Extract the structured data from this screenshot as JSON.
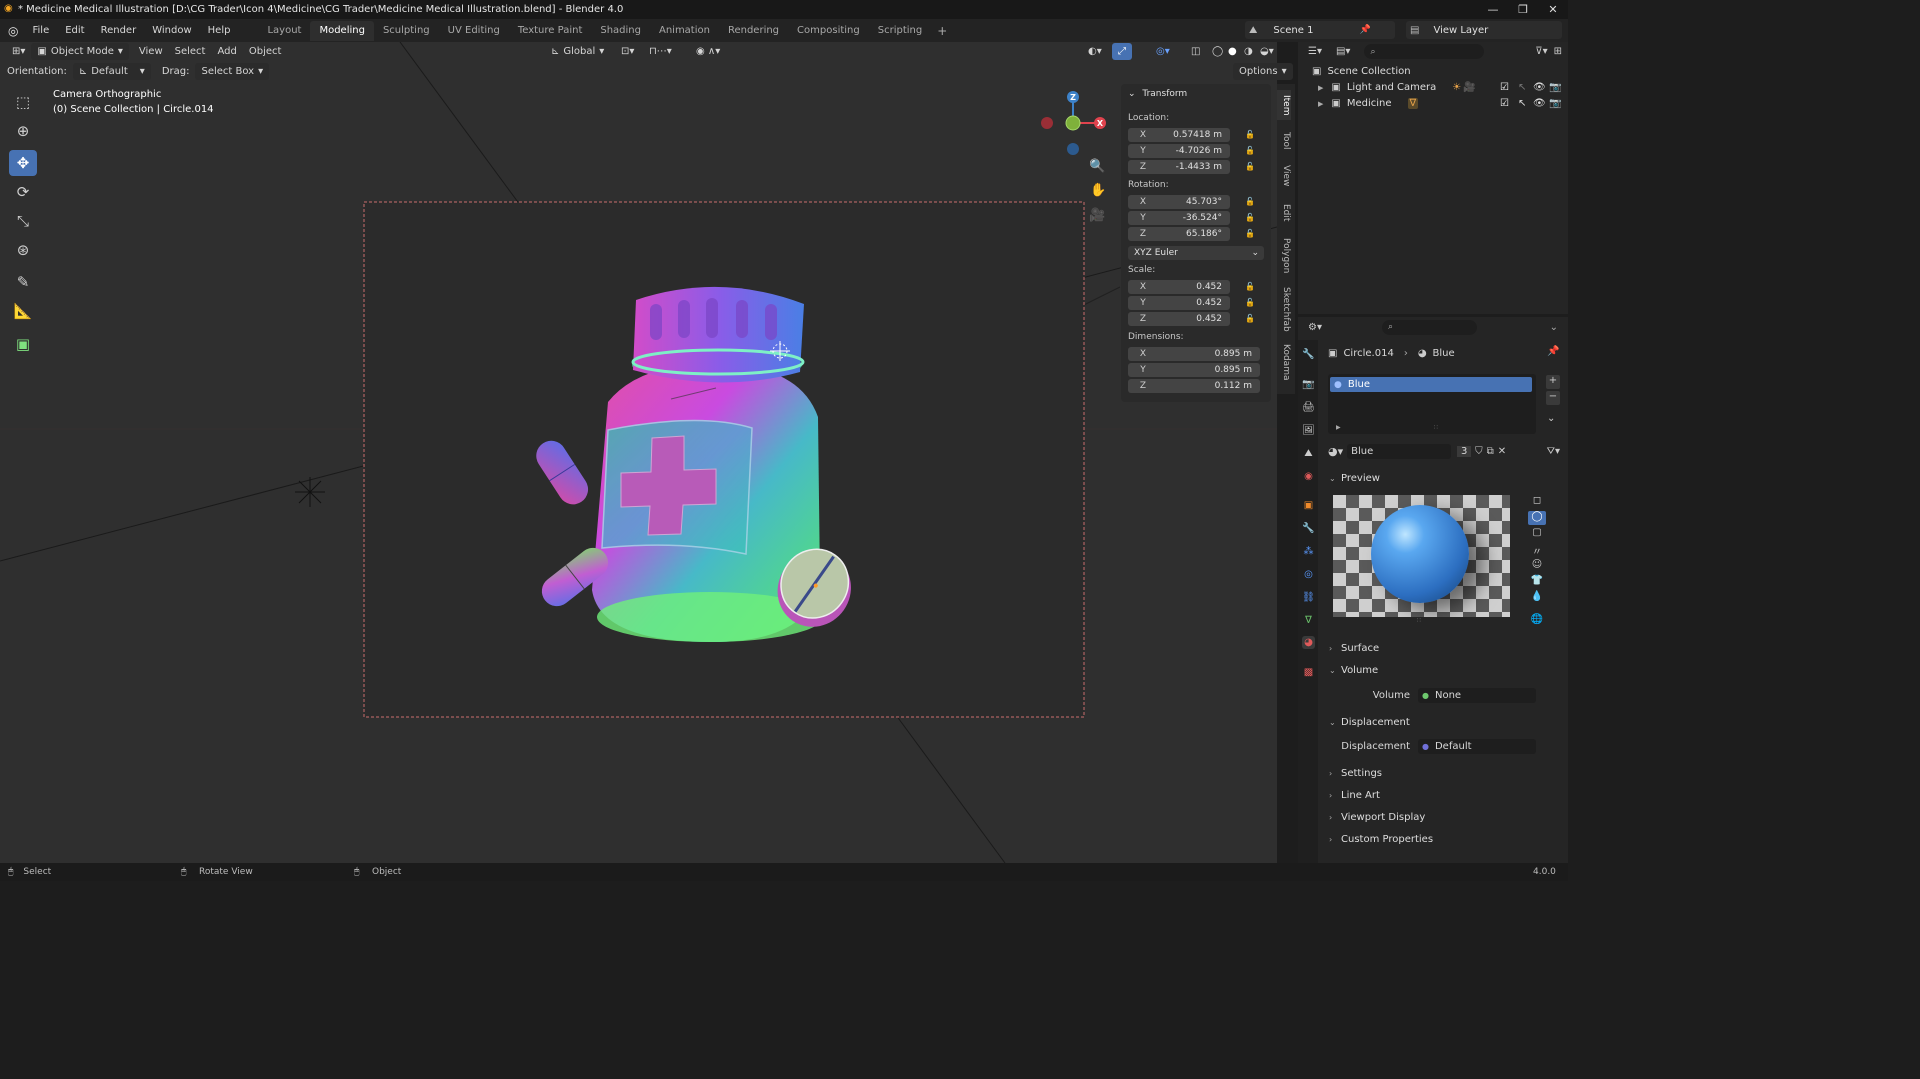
{
  "window": {
    "title": "* Medicine Medical Illustration [D:\\CG Trader\\Icon 4\\Medicine\\CG Trader\\Medicine Medical Illustration.blend] - Blender 4.0"
  },
  "menu": [
    "File",
    "Edit",
    "Render",
    "Window",
    "Help"
  ],
  "workspaces": [
    "Layout",
    "Modeling",
    "Sculpting",
    "UV Editing",
    "Texture Paint",
    "Shading",
    "Animation",
    "Rendering",
    "Compositing",
    "Scripting"
  ],
  "active_workspace": "Modeling",
  "scene": "Scene 1",
  "view_layer": "View Layer",
  "viewport_header": {
    "mode": "Object Mode",
    "menus": [
      "View",
      "Select",
      "Add",
      "Object"
    ],
    "transform_orientation": "Global",
    "options": "Options"
  },
  "tool_settings": {
    "orientation_label": "Orientation:",
    "orientation_value": "Default",
    "drag_label": "Drag:",
    "drag_value": "Select Box"
  },
  "overlay_text": {
    "view_name": "Camera Orthographic",
    "collection_info": "(0) Scene Collection | Circle.014"
  },
  "transform_panel": {
    "title": "Transform",
    "location_label": "Location:",
    "location": {
      "x": "0.57418 m",
      "y": "-4.7026 m",
      "z": "-1.4433 m"
    },
    "rotation_label": "Rotation:",
    "rotation": {
      "x": "45.703°",
      "y": "-36.524°",
      "z": "65.186°"
    },
    "rotation_mode": "XYZ Euler",
    "scale_label": "Scale:",
    "scale": {
      "x": "0.452",
      "y": "0.452",
      "z": "0.452"
    },
    "dimensions_label": "Dimensions:",
    "dimensions": {
      "x": "0.895 m",
      "y": "0.895 m",
      "z": "0.112 m"
    }
  },
  "sidebar_tabs": [
    "Item",
    "Tool",
    "View",
    "Edit",
    "Polygon",
    "Sketchfab",
    "Kodama"
  ],
  "outliner": {
    "root": "Scene Collection",
    "items": [
      "Light and Camera",
      "Medicine"
    ]
  },
  "properties": {
    "breadcrumb_object": "Circle.014",
    "breadcrumb_material": "Blue",
    "material_slot": "Blue",
    "material_name": "Blue",
    "material_users": "3",
    "sections": {
      "preview": "Preview",
      "surface": "Surface",
      "volume": "Volume",
      "volume_field_label": "Volume",
      "volume_field_value": "None",
      "displacement": "Displacement",
      "displacement_field_label": "Displacement",
      "displacement_field_value": "Default",
      "settings": "Settings",
      "line_art": "Line Art",
      "viewport_display": "Viewport Display",
      "custom_properties": "Custom Properties"
    }
  },
  "status_bar": {
    "left_action": "Select",
    "middle_action": "Rotate View",
    "right_action": "Object",
    "version": "4.0.0"
  },
  "colors": {
    "accent": "#4772b3",
    "axis_x": "#e0434e",
    "axis_y": "#7fb13b",
    "axis_z": "#3d82c9"
  }
}
